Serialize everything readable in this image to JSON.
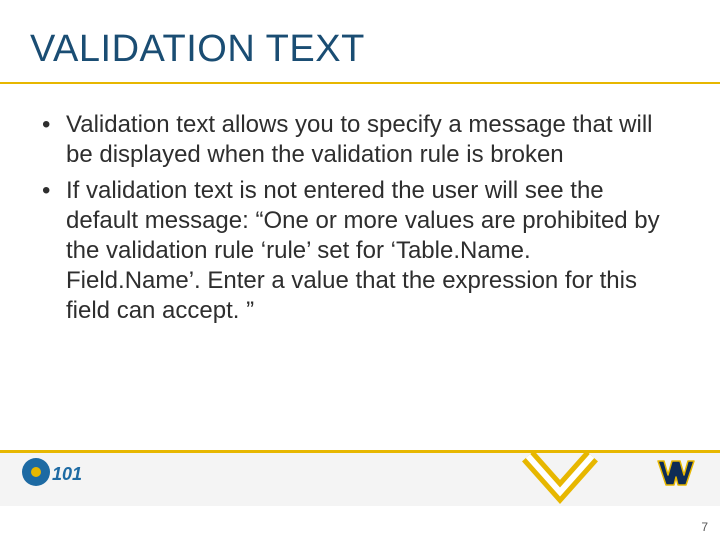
{
  "title": "VALIDATION TEXT",
  "bullets": [
    "Validation text allows you to specify a message that will be displayed when the validation rule is broken",
    "If validation text is not entered the user will see the default message: “One or more values are prohibited by the validation rule ‘rule’ set for ‘Table.Name. Field.Name’. Enter a value that the expression for this field can accept. ”"
  ],
  "page_number": "7",
  "colors": {
    "title": "#1a4d73",
    "accent": "#e7b700",
    "text": "#2e2e2e",
    "wv_blue": "#0d2b55",
    "wv_gold": "#e7b700"
  }
}
